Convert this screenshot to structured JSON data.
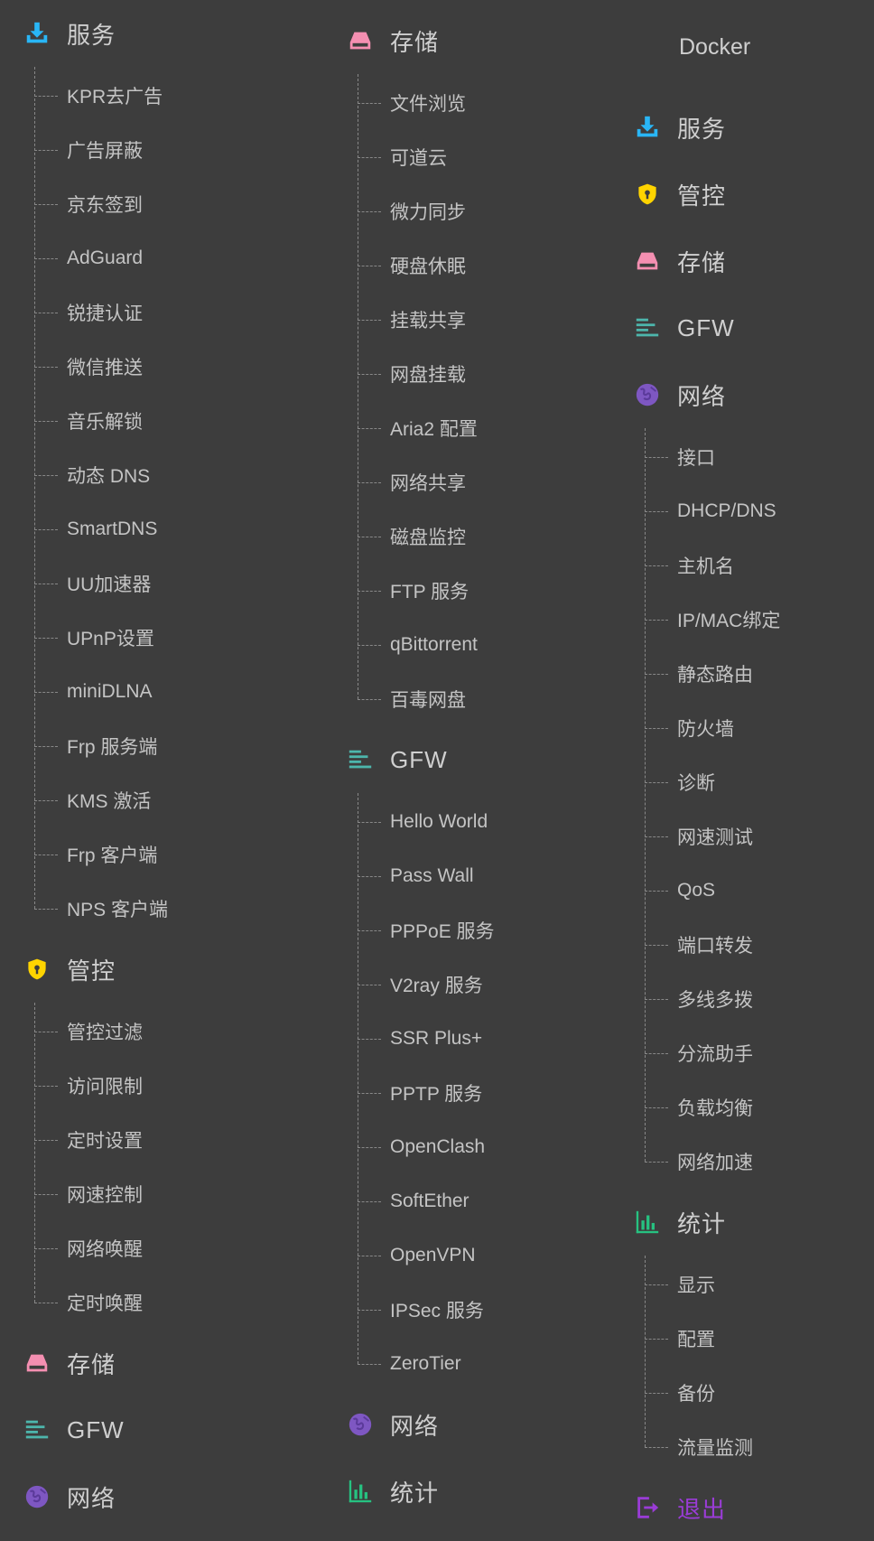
{
  "col1": {
    "fuwu": {
      "title": "服务",
      "items": [
        "KPR去广告",
        "广告屏蔽",
        "京东签到",
        "AdGuard",
        "锐捷认证",
        "微信推送",
        "音乐解锁",
        "动态 DNS",
        "SmartDNS",
        "UU加速器",
        "UPnP设置",
        "miniDLNA",
        "Frp 服务端",
        "KMS 激活",
        "Frp 客户端",
        "NPS 客户端"
      ]
    },
    "guankong": {
      "title": "管控",
      "items": [
        "管控过滤",
        "访问限制",
        "定时设置",
        "网速控制",
        "网络唤醒",
        "定时唤醒"
      ]
    },
    "cunchu": {
      "title": "存储"
    },
    "gfw": {
      "title": "GFW"
    },
    "wangluo": {
      "title": "网络"
    }
  },
  "col2": {
    "cunchu": {
      "title": "存储",
      "items": [
        "文件浏览",
        "可道云",
        "微力同步",
        "硬盘休眠",
        "挂载共享",
        "网盘挂载",
        "Aria2 配置",
        "网络共享",
        "磁盘监控",
        "FTP 服务",
        "qBittorrent",
        "百毒网盘"
      ]
    },
    "gfw": {
      "title": "GFW",
      "items": [
        "Hello World",
        "Pass Wall",
        "PPPoE 服务",
        "V2ray 服务",
        "SSR Plus+",
        "PPTP 服务",
        "OpenClash",
        "SoftEther",
        "OpenVPN",
        "IPSec 服务",
        "ZeroTier"
      ]
    },
    "wangluo": {
      "title": "网络"
    },
    "tongji": {
      "title": "统计"
    }
  },
  "col3": {
    "docker": "Docker",
    "fuwu": {
      "title": "服务"
    },
    "guankong": {
      "title": "管控"
    },
    "cunchu": {
      "title": "存储"
    },
    "gfw": {
      "title": "GFW"
    },
    "wangluo": {
      "title": "网络",
      "items": [
        "接口",
        "DHCP/DNS",
        "主机名",
        "IP/MAC绑定",
        "静态路由",
        "防火墙",
        "诊断",
        "网速测试",
        "QoS",
        "端口转发",
        "多线多拨",
        "分流助手",
        "负载均衡",
        "网络加速"
      ]
    },
    "tongji": {
      "title": "统计",
      "items": [
        "显示",
        "配置",
        "备份",
        "流量监测"
      ]
    },
    "logout": {
      "title": "退出"
    }
  },
  "colors": {
    "background": "#3d3d3d",
    "download_icon": "#29b6f6",
    "shield_icon": "#ffd400",
    "storage_icon": "#f48fb1",
    "gfw_icon": "#4db6ac",
    "network_icon": "#7e57c2",
    "stats_icon": "#26c281",
    "logout": "#9a3cd6"
  }
}
